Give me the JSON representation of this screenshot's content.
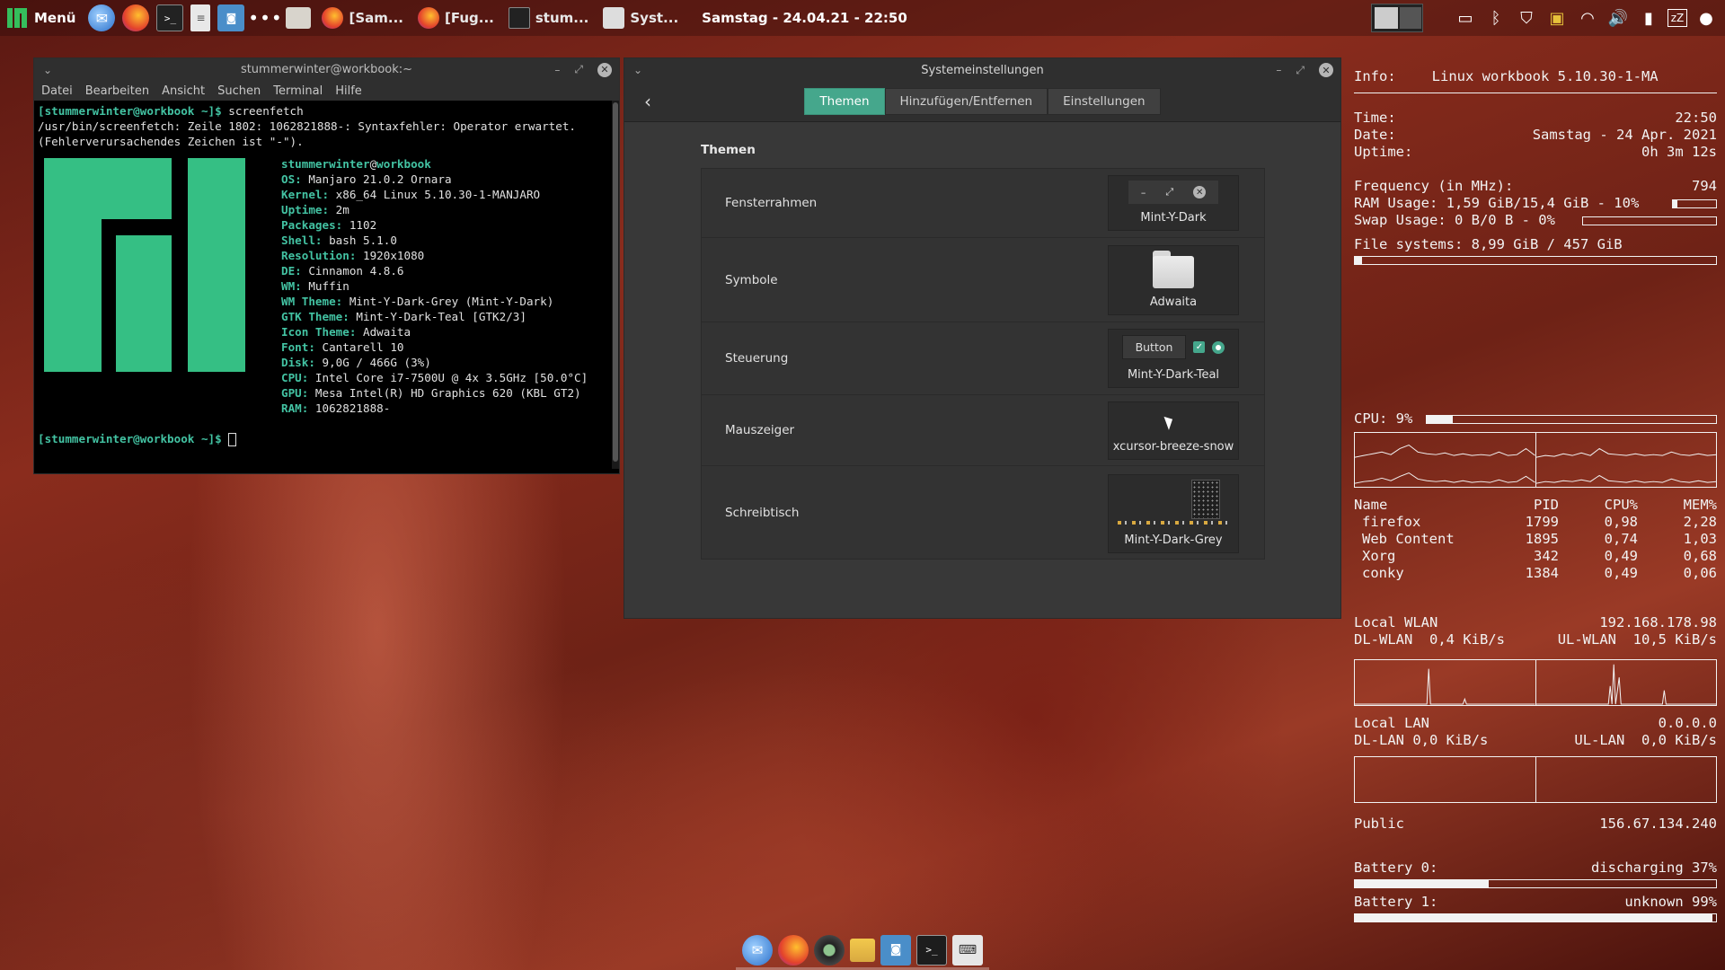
{
  "top_panel": {
    "menu_label": "Menü",
    "tasks": [
      {
        "label": "[Sam...",
        "icon": "firefox-icon"
      },
      {
        "label": "[Fug...",
        "icon": "firefox-icon"
      },
      {
        "label": "stum...",
        "icon": "terminal-icon"
      },
      {
        "label": "Syst...",
        "icon": "settings-icon"
      }
    ],
    "clock": "Samstag - 24.04.21 - 22:50"
  },
  "terminal": {
    "title": "stummerwinter@workbook:~",
    "menu": [
      "Datei",
      "Bearbeiten",
      "Ansicht",
      "Suchen",
      "Terminal",
      "Hilfe"
    ],
    "prompt": "[stummerwinter@workbook ~]$",
    "command": " screenfetch",
    "error_line1": "/usr/bin/screenfetch: Zeile 1802: 1062821888-: Syntaxfehler: Operator erwartet.",
    "error_line2": "(Fehlerverursachendes Zeichen ist \"-\").",
    "user": "stummerwinter",
    "at": "@",
    "host": "workbook",
    "info": [
      {
        "k": "OS:",
        "v": " Manjaro 21.0.2 Ornara"
      },
      {
        "k": "Kernel:",
        "v": " x86_64 Linux 5.10.30-1-MANJARO"
      },
      {
        "k": "Uptime:",
        "v": " 2m"
      },
      {
        "k": "Packages:",
        "v": " 1102"
      },
      {
        "k": "Shell:",
        "v": " bash 5.1.0"
      },
      {
        "k": "Resolution:",
        "v": " 1920x1080"
      },
      {
        "k": "DE:",
        "v": " Cinnamon 4.8.6"
      },
      {
        "k": "WM:",
        "v": " Muffin"
      },
      {
        "k": "WM Theme:",
        "v": " Mint-Y-Dark-Grey (Mint-Y-Dark)"
      },
      {
        "k": "GTK Theme:",
        "v": " Mint-Y-Dark-Teal [GTK2/3]"
      },
      {
        "k": "Icon Theme:",
        "v": " Adwaita"
      },
      {
        "k": "Font:",
        "v": " Cantarell 10"
      },
      {
        "k": "Disk:",
        "v": " 9,0G / 466G (3%)"
      },
      {
        "k": "CPU:",
        "v": " Intel Core i7-7500U @ 4x 3.5GHz [50.0°C]"
      },
      {
        "k": "GPU:",
        "v": " Mesa Intel(R) HD Graphics 620 (KBL GT2)"
      },
      {
        "k": "RAM:",
        "v": " 1062821888-"
      }
    ]
  },
  "settings": {
    "title": "Systemeinstellungen",
    "tabs": [
      "Themen",
      "Hinzufügen/Entfernen",
      "Einstellungen"
    ],
    "active_tab": 0,
    "section_title": "Themen",
    "rows": [
      {
        "label": "Fensterrahmen",
        "value": "Mint-Y-Dark"
      },
      {
        "label": "Symbole",
        "value": "Adwaita"
      },
      {
        "label": "Steuerung",
        "value": "Mint-Y-Dark-Teal",
        "button_label": "Button"
      },
      {
        "label": "Mauszeiger",
        "value": "xcursor-breeze-snow"
      },
      {
        "label": "Schreibtisch",
        "value": "Mint-Y-Dark-Grey"
      }
    ]
  },
  "conky": {
    "info_label": "Info:",
    "info_value": "Linux workbook 5.10.30-1-MA",
    "time_label": "Time:",
    "time_value": "22:50",
    "date_label": "Date:",
    "date_value": "Samstag - 24 Apr. 2021",
    "uptime_label": "Uptime:",
    "uptime_value": "0h 3m 12s",
    "freq_label": "Frequency (in MHz):",
    "freq_value": "794",
    "ram_label": "RAM Usage: 1,59 GiB/15,4 GiB - 10%",
    "ram_fraction": 0.1,
    "swap_label": "Swap Usage: 0 B/0 B - 0%",
    "swap_fraction": 0.0,
    "fs_label": "File systems: 8,99 GiB / 457 GiB",
    "fs_fraction": 0.02,
    "cpu_label": "CPU: 9%",
    "cpu_fraction": 0.09,
    "proc_header": [
      "Name",
      "PID",
      "CPU%",
      "MEM%"
    ],
    "processes": [
      [
        "firefox",
        "1799",
        "0,98",
        "2,28"
      ],
      [
        "Web Content",
        "1895",
        "0,74",
        "1,03"
      ],
      [
        "Xorg",
        "342",
        "0,49",
        "0,68"
      ],
      [
        "conky",
        "1384",
        "0,49",
        "0,06"
      ]
    ],
    "wlan_label": "Local WLAN",
    "wlan_ip": "192.168.178.98",
    "dl_wlan": "DL-WLAN  0,4 KiB/s",
    "ul_wlan": "UL-WLAN  10,5 KiB/s",
    "lan_label": "Local LAN",
    "lan_ip": "0.0.0.0",
    "dl_lan": "DL-LAN 0,0 KiB/s",
    "ul_lan": "UL-LAN  0,0 KiB/s",
    "public_label": "Public",
    "public_ip": "156.67.134.240",
    "bat0_label": "Battery 0:",
    "bat0_value": "discharging 37%",
    "bat0_fraction": 0.37,
    "bat1_label": "Battery 1:",
    "bat1_value": "unknown 99%",
    "bat1_fraction": 0.99
  },
  "colors": {
    "accent": "#45a78c",
    "manjaro_green": "#35bf84",
    "prompt_teal": "#43c3a3"
  }
}
